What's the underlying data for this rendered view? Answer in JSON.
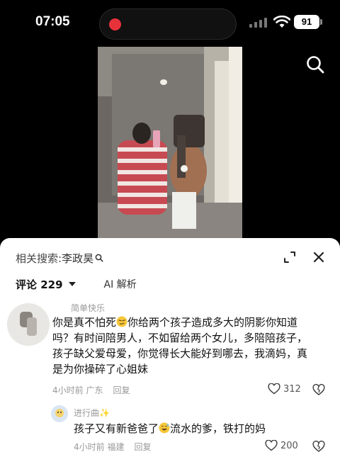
{
  "status_bar": {
    "time": "07:05",
    "battery": "91"
  },
  "sheet": {
    "related_label": "相关搜索:",
    "related_query": "李政昊",
    "tabs": {
      "comments": "评论 229",
      "ai": "AI 解析"
    }
  },
  "comments": [
    {
      "user": "简单快乐",
      "text_part1": "你是真不怕死",
      "text_part2": "你给两个孩子造成多大的阴影你知道吗？有时间陪男人，不如留给两个女儿，多陪陪孩子，孩子缺父爱母爱，你觉得长大能好到哪去，我滴妈，真是为你操碎了心姐妹",
      "time_location": "4小时前 广东",
      "reply_label": "回复",
      "likes": "312"
    },
    {
      "user": "进行曲✨",
      "text_part1": "孩子又有新爸爸了",
      "text_part2": "流水的爹，铁打的妈",
      "time_location": "4小时前 福建",
      "reply_label": "回复",
      "likes": "200"
    }
  ],
  "colors": {
    "rec": "#e8323a",
    "sheet_bg": "#ffffff",
    "emoji": "#f5c73c"
  }
}
